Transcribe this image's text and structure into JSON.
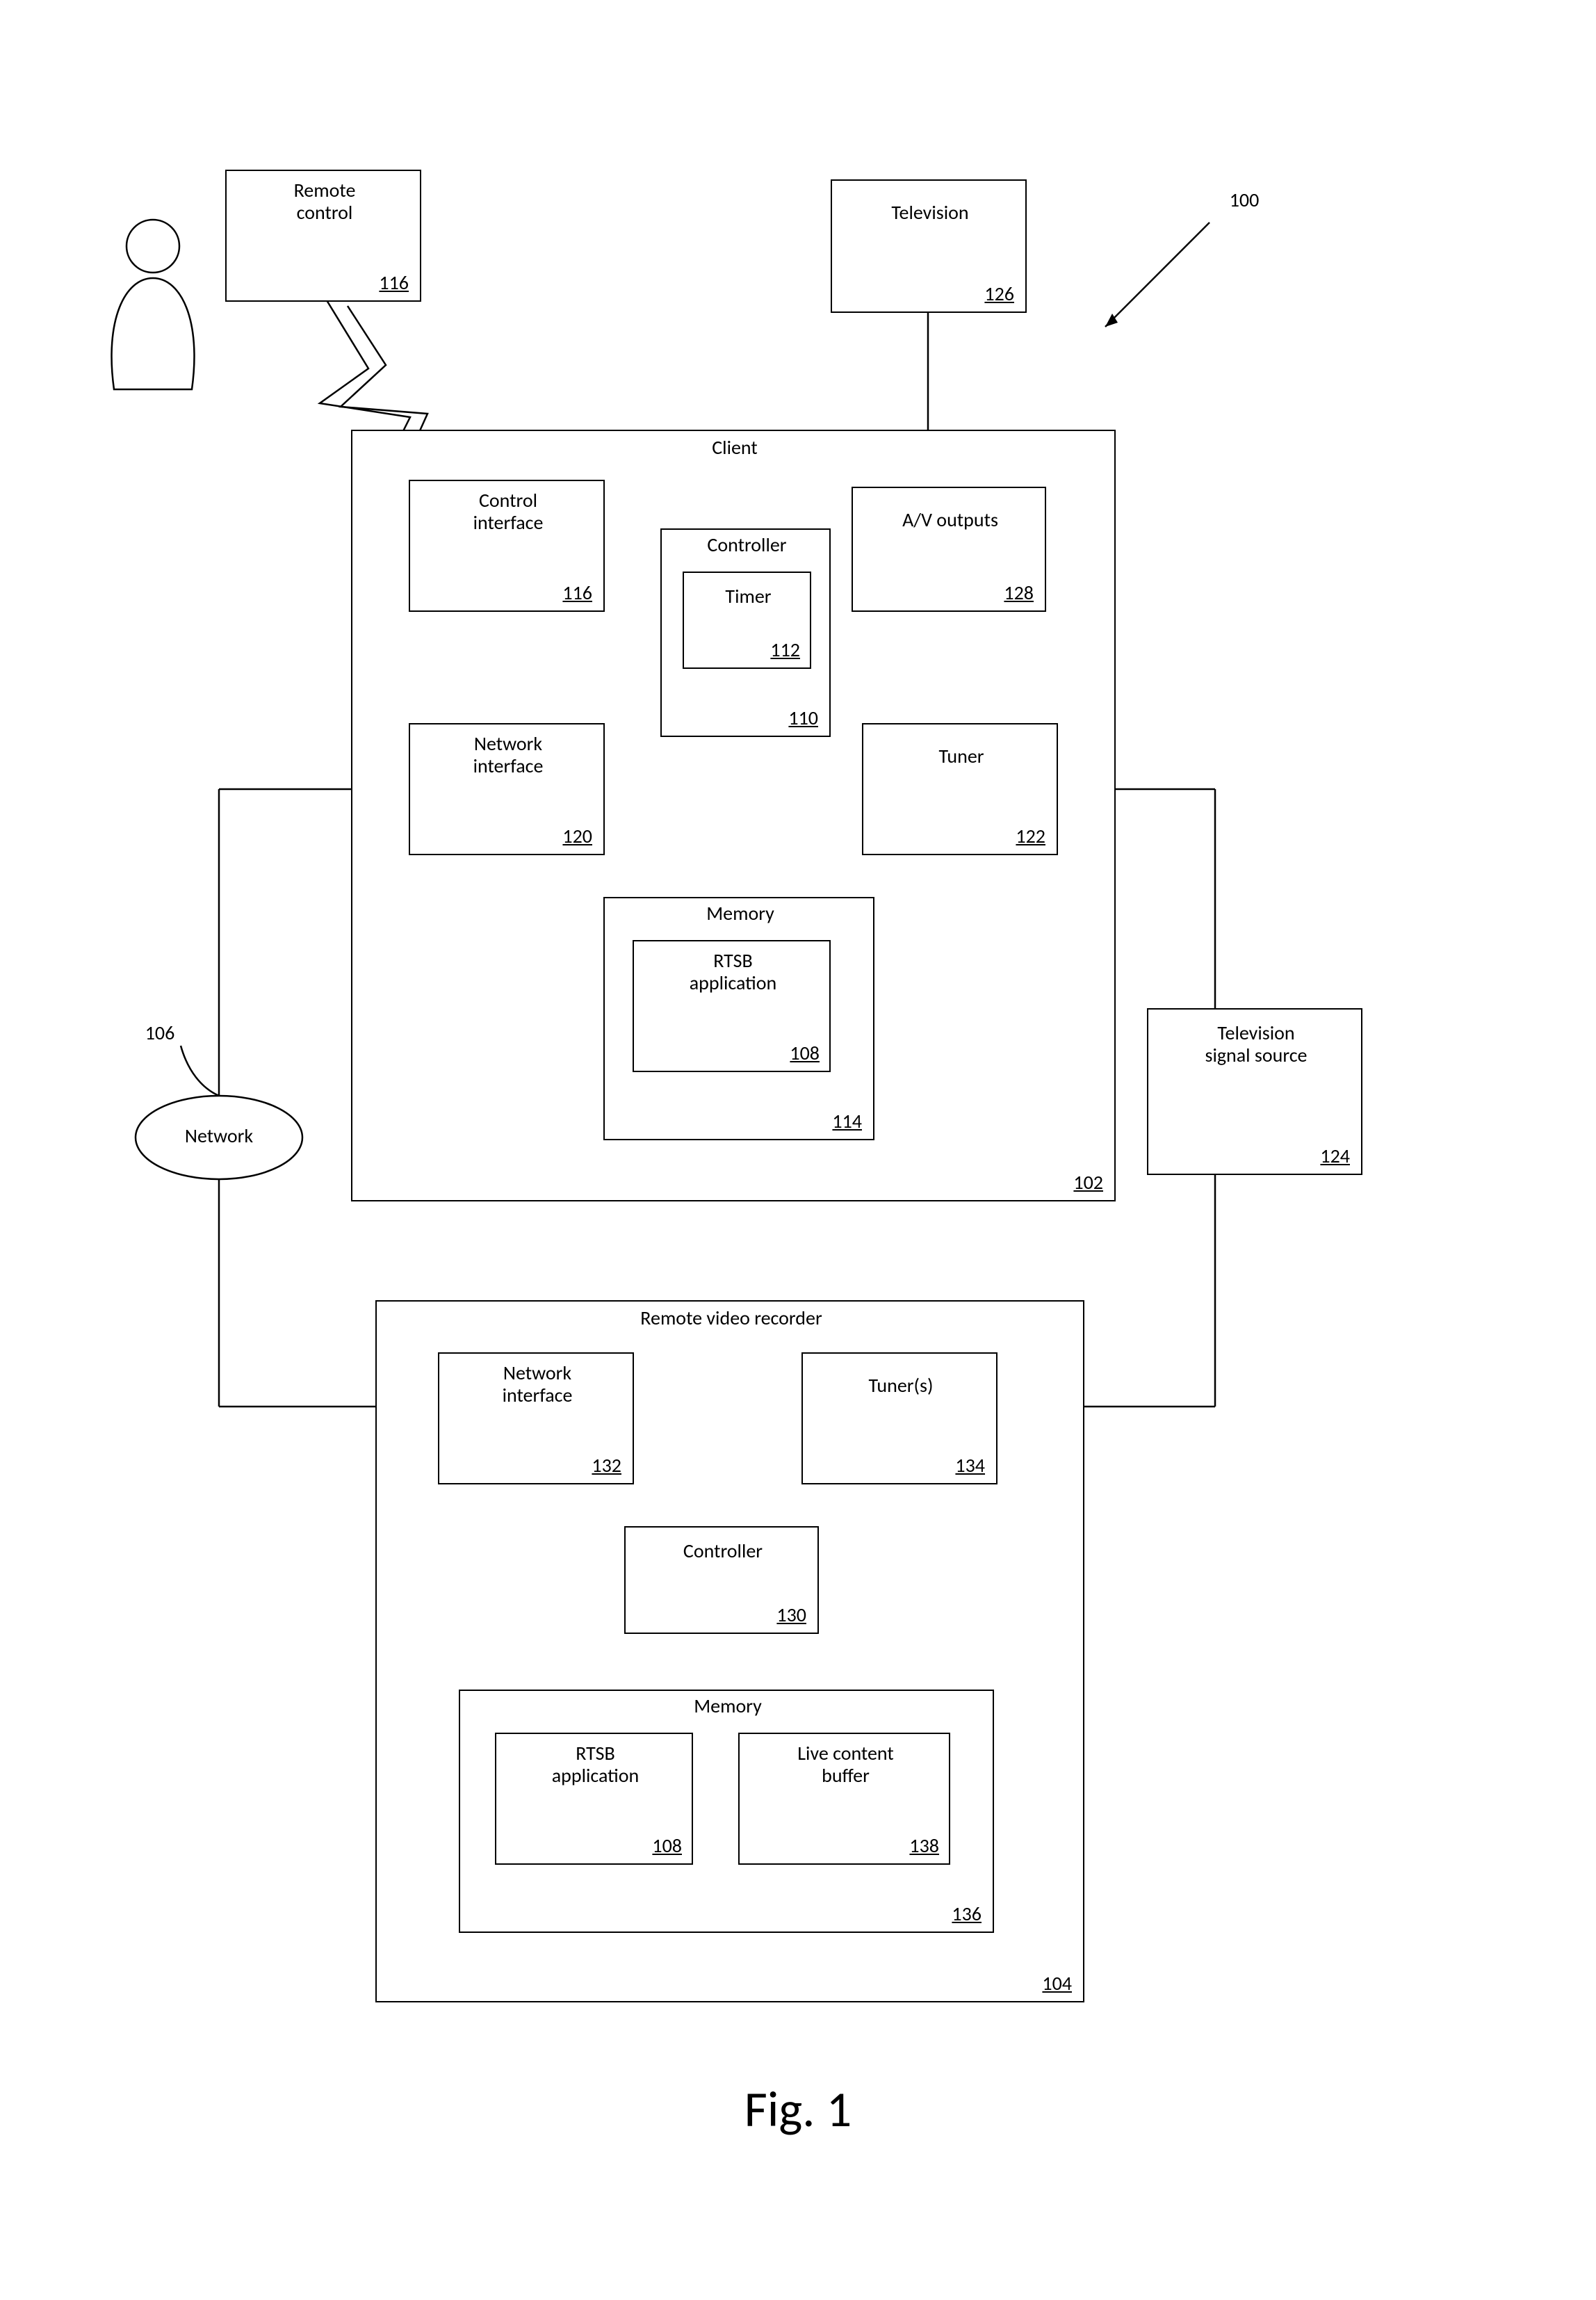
{
  "figure_label": "Fig. 1",
  "system_ref": "100",
  "network_ref": "106",
  "remote_control": {
    "label": "Remote\ncontrol",
    "ref": "116"
  },
  "television": {
    "label": "Television",
    "ref": "126"
  },
  "client": {
    "label": "Client",
    "ref": "102",
    "control_interface": {
      "label": "Control\ninterface",
      "ref": "116"
    },
    "av_outputs": {
      "label": "A/V outputs",
      "ref": "128"
    },
    "controller": {
      "label": "Controller",
      "ref": "110",
      "timer": {
        "label": "Timer",
        "ref": "112"
      }
    },
    "network_interface": {
      "label": "Network\ninterface",
      "ref": "120"
    },
    "tuner": {
      "label": "Tuner",
      "ref": "122"
    },
    "memory": {
      "label": "Memory",
      "ref": "114",
      "rtsb": {
        "label": "RTSB\napplication",
        "ref": "108"
      }
    }
  },
  "signal_source": {
    "label": "Television\nsignal source",
    "ref": "124"
  },
  "network_node": {
    "label": "Network"
  },
  "rvr": {
    "label": "Remote video recorder",
    "ref": "104",
    "network_interface": {
      "label": "Network\ninterface",
      "ref": "132"
    },
    "tuners": {
      "label": "Tuner(s)",
      "ref": "134"
    },
    "controller": {
      "label": "Controller",
      "ref": "130"
    },
    "memory": {
      "label": "Memory",
      "ref": "136",
      "rtsb": {
        "label": "RTSB\napplication",
        "ref": "108"
      },
      "buffer": {
        "label": "Live content\nbuffer",
        "ref": "138"
      }
    }
  }
}
